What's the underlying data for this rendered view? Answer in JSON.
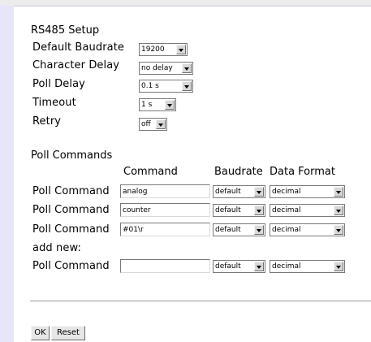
{
  "rs485": {
    "title": "RS485 Setup",
    "baudrate_label": "Default Baudrate",
    "baudrate_value": "19200",
    "char_delay_label": "Character Delay",
    "char_delay_value": "no delay",
    "poll_delay_label": "Poll Delay",
    "poll_delay_value": "0.1 s",
    "timeout_label": "Timeout",
    "timeout_value": "1 s",
    "retry_label": "Retry",
    "retry_value": "off"
  },
  "poll": {
    "title": "Poll Commands",
    "col_command": "Command",
    "col_baudrate": "Baudrate",
    "col_format": "Data Format",
    "row_label": "Poll Command",
    "rows": [
      {
        "command": "analog",
        "baudrate": "default",
        "format": "decimal"
      },
      {
        "command": "counter",
        "baudrate": "default",
        "format": "decimal"
      },
      {
        "command": "#01\\r",
        "baudrate": "default",
        "format": "decimal"
      }
    ],
    "add_new_label": "add new:",
    "new_row": {
      "command": "",
      "baudrate": "default",
      "format": "decimal"
    }
  },
  "buttons": {
    "ok": "OK",
    "reset": "Reset"
  }
}
